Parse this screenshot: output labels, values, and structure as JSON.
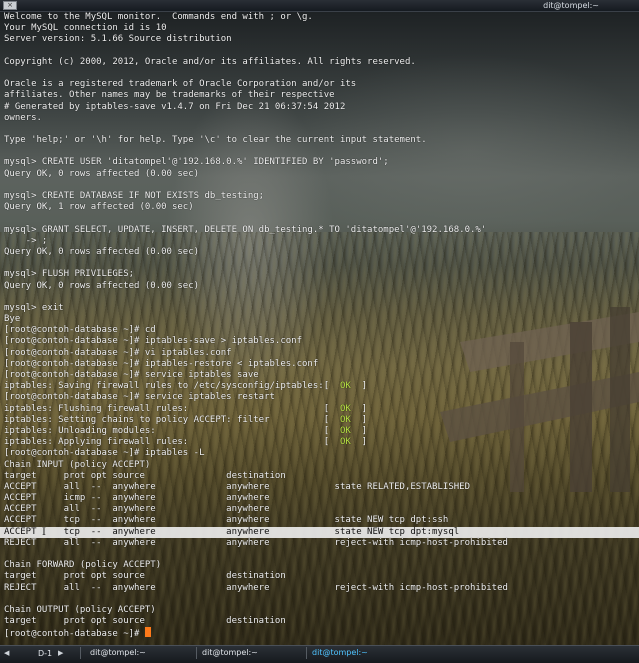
{
  "window": {
    "title": "dit@tompel:~",
    "close_glyph": "×"
  },
  "terminal": {
    "lines": [
      "Welcome to the MySQL monitor.  Commands end with ; or \\g.",
      "Your MySQL connection id is 10",
      "Server version: 5.1.66 Source distribution",
      "",
      "Copyright (c) 2000, 2012, Oracle and/or its affiliates. All rights reserved.",
      "",
      "Oracle is a registered trademark of Oracle Corporation and/or its",
      "affiliates. Other names may be trademarks of their respective",
      "# Generated by iptables-save v1.4.7 on Fri Dec 21 06:37:54 2012",
      "owners.",
      "",
      "Type 'help;' or '\\h' for help. Type '\\c' to clear the current input statement.",
      "",
      "mysql> CREATE USER 'ditatompel'@'192.168.0.%' IDENTIFIED BY 'password';",
      "Query OK, 0 rows affected (0.00 sec)",
      "",
      "mysql> CREATE DATABASE IF NOT EXISTS db_testing;",
      "Query OK, 1 row affected (0.00 sec)",
      "",
      "mysql> GRANT SELECT, UPDATE, INSERT, DELETE ON db_testing.* TO 'ditatompel'@'192.168.0.%'",
      "    -> ;",
      "Query OK, 0 rows affected (0.00 sec)",
      "",
      "mysql> FLUSH PRIVILEGES;",
      "Query OK, 0 rows affected (0.00 sec)",
      "",
      "mysql> exit",
      "Bye",
      "[root@contoh-database ~]# cd",
      "[root@contoh-database ~]# iptables-save > iptables.conf",
      "[root@contoh-database ~]# vi iptables.conf",
      "[root@contoh-database ~]# iptables-restore < iptables.conf",
      "[root@contoh-database ~]# service iptables save",
      "iptables: Saving firewall rules to /etc/sysconfig/iptables:[  OK  ]",
      "[root@contoh-database ~]# service iptables restart",
      "iptables: Flushing firewall rules:                         [  OK  ]",
      "iptables: Setting chains to policy ACCEPT: filter          [  OK  ]",
      "iptables: Unloading modules:                               [  OK  ]",
      "iptables: Applying firewall rules:                         [  OK  ]",
      "[root@contoh-database ~]# iptables -L",
      "Chain INPUT (policy ACCEPT)",
      "target     prot opt source               destination",
      "ACCEPT     all  --  anywhere             anywhere            state RELATED,ESTABLISHED",
      "ACCEPT     icmp --  anywhere             anywhere",
      "ACCEPT     all  --  anywhere             anywhere",
      "ACCEPT     tcp  --  anywhere             anywhere            state NEW tcp dpt:ssh",
      "ACCEPT     tcp  --  anywhere             anywhere            state NEW tcp dpt:mysql",
      "REJECT     all  --  anywhere             anywhere            reject-with icmp-host-prohibited",
      "",
      "Chain FORWARD (policy ACCEPT)",
      "target     prot opt source               destination",
      "REJECT     all  --  anywhere             anywhere            reject-with icmp-host-prohibited",
      "",
      "Chain OUTPUT (policy ACCEPT)",
      "target     prot opt source               destination",
      "[root@contoh-database ~]# "
    ],
    "selected_line_index": 46,
    "ok_token": "OK"
  },
  "taskbar": {
    "workspace": "D-1",
    "tasks": [
      "dit@tompel:~",
      "dit@tompel:~",
      "dit@tompel:~"
    ],
    "active_task_index": 2
  },
  "colors": {
    "text": "#f0f0f0",
    "ok": "#b6e044",
    "cursor": "#ff7a1a",
    "selection": "#ebebeb",
    "active_task": "#4fc3ff"
  }
}
